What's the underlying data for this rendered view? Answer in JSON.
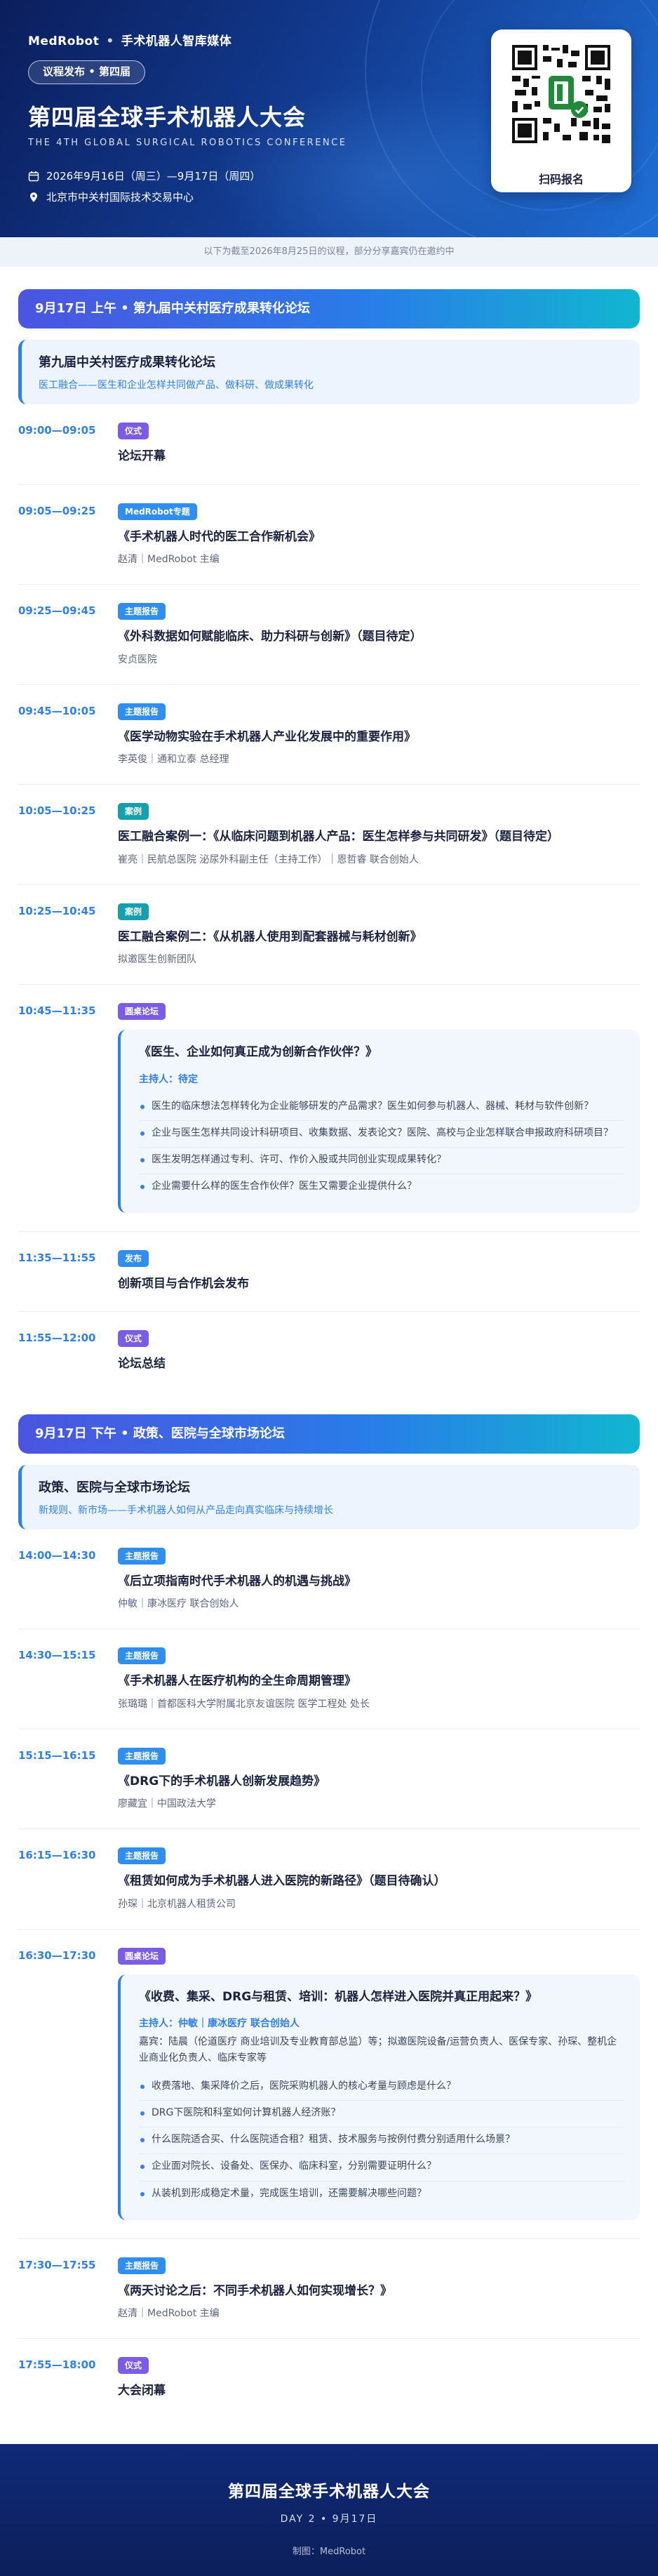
{
  "header": {
    "brand": "MedRobot",
    "tagline": "手术机器人智库媒体",
    "pill": "议程发布 • 第四届",
    "title": "第四届全球手术机器人大会",
    "subtitle": "THE 4TH GLOBAL SURGICAL ROBOTICS CONFERENCE",
    "date": "2026年9月16日（周三）—9月17日（周四）",
    "venue": "北京市中关村国际技术交易中心",
    "qr_label": "扫码报名"
  },
  "notice": "以下为截至2026年8月25日的议程，部分分享嘉宾仍在邀约中",
  "sessions": [
    {
      "bar": "9月17日 上午 • 第九届中关村医疗成果转化论坛",
      "forum_title": "第九届中关村医疗成果转化论坛",
      "forum_sub": "医工融合——医生和企业怎样共同做产品、做科研、做成果转化",
      "items": [
        {
          "time": "09:00—09:05",
          "tag": "仪式",
          "title": "论坛开幕",
          "speaker": ""
        },
        {
          "time": "09:05—09:25",
          "tag": "MedRobot专题",
          "title": "《手术机器人时代的医工合作新机会》",
          "speaker": "赵清｜MedRobot 主编"
        },
        {
          "time": "09:25—09:45",
          "tag": "主题报告",
          "title": "《外科数据如何赋能临床、助力科研与创新》（题目待定）",
          "speaker": "安贞医院"
        },
        {
          "time": "09:45—10:05",
          "tag": "主题报告",
          "title": "《医学动物实验在手术机器人产业化发展中的重要作用》",
          "speaker": "李英俊｜通和立泰 总经理"
        },
        {
          "time": "10:05—10:25",
          "tag": "案例",
          "title": "医工融合案例一：《从临床问题到机器人产品：医生怎样参与共同研发》（题目待定）",
          "speaker": "崔亮｜民航总医院 泌尿外科副主任（主持工作）｜恩哲睿 联合创始人"
        },
        {
          "time": "10:25—10:45",
          "tag": "案例",
          "title": "医工融合案例二：《从机器人使用到配套器械与耗材创新》",
          "speaker": "拟邀医生创新团队"
        },
        {
          "time": "10:45—11:35",
          "tag": "圆桌论坛",
          "title": "",
          "speaker": ""
        },
        {
          "time": "11:35—11:55",
          "tag": "发布",
          "title": "创新项目与合作机会发布",
          "speaker": ""
        },
        {
          "time": "11:55—12:00",
          "tag": "仪式",
          "title": "论坛总结",
          "speaker": ""
        }
      ],
      "panel": {
        "title": "《医生、企业如何真正成为创新合作伙伴？》",
        "host": "主持人：待定",
        "guests": "",
        "questions": [
          "医生的临床想法怎样转化为企业能够研发的产品需求？医生如何参与机器人、器械、耗材与软件创新？",
          "企业与医生怎样共同设计科研项目、收集数据、发表论文？医院、高校与企业怎样联合申报政府科研项目？",
          "医生发明怎样通过专利、许可、作价入股或共同创业实现成果转化？",
          "企业需要什么样的医生合作伙伴？医生又需要企业提供什么？"
        ]
      }
    },
    {
      "bar": "9月17日 下午 • 政策、医院与全球市场论坛",
      "forum_title": "政策、医院与全球市场论坛",
      "forum_sub": "新规则、新市场——手术机器人如何从产品走向真实临床与持续增长",
      "items": [
        {
          "time": "14:00—14:30",
          "tag": "主题报告",
          "title": "《后立项指南时代手术机器人的机遇与挑战》",
          "speaker": "仲敏｜康冰医疗 联合创始人"
        },
        {
          "time": "14:30—15:15",
          "tag": "主题报告",
          "title": "《手术机器人在医疗机构的全生命周期管理》",
          "speaker": "张璐璐｜首都医科大学附属北京友谊医院 医学工程处 处长"
        },
        {
          "time": "15:15—16:15",
          "tag": "主题报告",
          "title": "《DRG下的手术机器人创新发展趋势》",
          "speaker": "廖藏宜｜中国政法大学"
        },
        {
          "time": "16:15—16:30",
          "tag": "主题报告",
          "title": "《租赁如何成为手术机器人进入医院的新路径》（题目待确认）",
          "speaker": "孙琛｜北京机器人租赁公司"
        },
        {
          "time": "16:30—17:30",
          "tag": "圆桌论坛",
          "title": "",
          "speaker": ""
        },
        {
          "time": "17:30—17:55",
          "tag": "主题报告",
          "title": "《两天讨论之后：不同手术机器人如何实现增长？》",
          "speaker": "赵清｜MedRobot 主编"
        },
        {
          "time": "17:55—18:00",
          "tag": "仪式",
          "title": "大会闭幕",
          "speaker": ""
        }
      ],
      "panel": {
        "title": "《收费、集采、DRG与租赁、培训：机器人怎样进入医院并真正用起来？》",
        "host": "主持人：仲敏｜康冰医疗 联合创始人",
        "guests": "嘉宾：陆晨（伦道医疗 商业培训及专业教育部总监）等；拟邀医院设备/运营负责人、医保专家、孙琛、整机企业商业化负责人、临床专家等",
        "questions": [
          "收费落地、集采降价之后，医院采购机器人的核心考量与顾虑是什么？",
          "DRG下医院和科室如何计算机器人经济账？",
          "什么医院适合买、什么医院适合租？租赁、技术服务与按例付费分别适用什么场景？",
          "企业面对院长、设备处、医保办、临床科室，分别需要证明什么？",
          "从装机到形成稳定术量，完成医生培训，还需要解决哪些问题？"
        ]
      }
    }
  ],
  "footer": {
    "title": "第四届全球手术机器人大会",
    "day": "DAY 2 • 9月17日",
    "credit": "制图：MedRobot"
  },
  "colors": {
    "accent": "#2f80ed",
    "tag_purple": "#7b5ce6",
    "tag_blue": "#2f8ef0",
    "tag_teal": "#14a0ad",
    "hero_dark": "#0b1e5c"
  }
}
